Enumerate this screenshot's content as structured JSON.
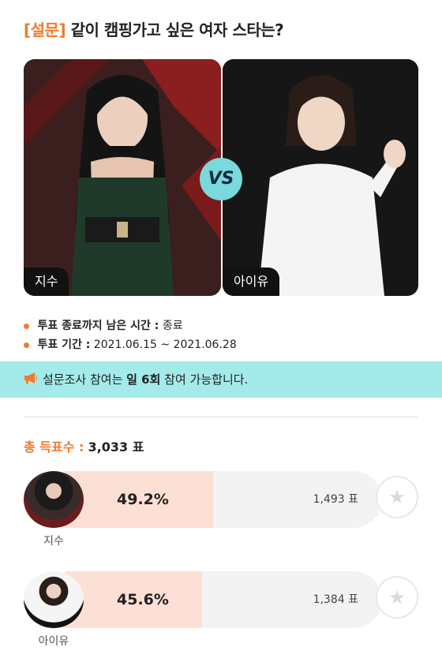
{
  "survey": {
    "tag": "[설문]",
    "question": "같이 캠핑가고 싶은 여자 스타는?"
  },
  "candidates": [
    {
      "name": "지수"
    },
    {
      "name": "아이유"
    }
  ],
  "vs_label": "VS",
  "info": {
    "remaining_label": "투표 종료까지 남은 시간 :",
    "remaining_value": "종료",
    "period_label": "투표 기간 :",
    "period_value": "2021.06.15 ~ 2021.06.28"
  },
  "notice": {
    "icon": "megaphone-icon",
    "prefix": "설문조사 참여는 ",
    "highlight": "일 6회",
    "suffix": " 참여 가능합니다."
  },
  "total": {
    "label": "총 득표수 :",
    "value": "3,033 표"
  },
  "results": [
    {
      "name": "지수",
      "percent": "49.2%",
      "percent_value": 49.2,
      "votes": "1,493 표"
    },
    {
      "name": "아이유",
      "percent": "45.6%",
      "percent_value": 45.6,
      "votes": "1,384 표"
    }
  ],
  "colors": {
    "accent": "#f07a2c",
    "vs_badge": "#79d9dc",
    "notice_bg": "#a4eaeb",
    "bar_fill": "#fde0d5",
    "bar_bg": "#f3f3f3"
  }
}
